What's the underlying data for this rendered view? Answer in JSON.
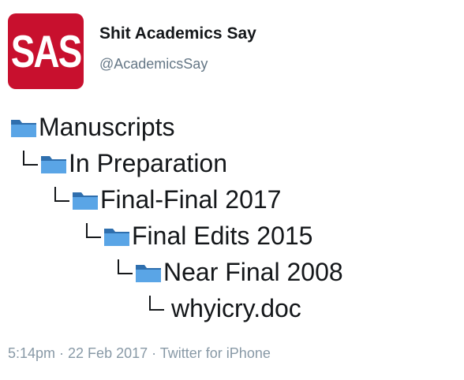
{
  "tweet": {
    "avatar_text": "SAS",
    "display_name": "Shit Academics Say",
    "handle": "@AcademicsSay",
    "timestamp": "5:14pm · 22 Feb 2017 · Twitter for iPhone"
  },
  "tree": [
    {
      "label": "Manuscripts",
      "icon": "folder-icon",
      "depth": 0
    },
    {
      "label": "In Preparation",
      "icon": "folder-icon",
      "depth": 1
    },
    {
      "label": "Final-Final 2017",
      "icon": "folder-icon",
      "depth": 2
    },
    {
      "label": "Final Edits 2015",
      "icon": "folder-icon",
      "depth": 3
    },
    {
      "label": "Near Final 2008",
      "icon": "folder-icon",
      "depth": 4
    },
    {
      "label": "whyicry.doc",
      "icon": "none",
      "depth": 5
    }
  ],
  "colors": {
    "avatar_bg": "#c8102e",
    "folder_front": "#5aa5e6",
    "folder_back": "#2f6fae",
    "meta_text": "#8899a6",
    "handle_text": "#657786"
  }
}
